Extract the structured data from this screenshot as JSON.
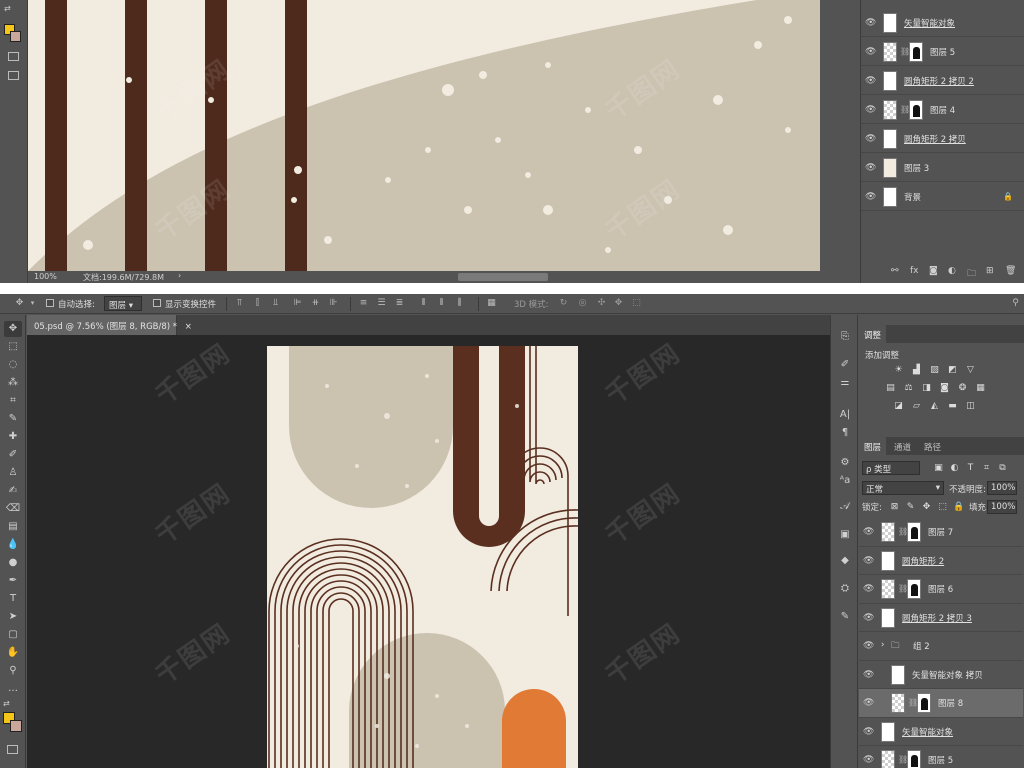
{
  "top": {
    "status_zoom": "100%",
    "status_doc": "文档:199.6M/729.8M",
    "layers": [
      {
        "name": "矢量智能对象",
        "smart": true,
        "type": "smart"
      },
      {
        "name": "图层 5",
        "smart": false,
        "type": "masked"
      },
      {
        "name": "圆角矩形 2 拷贝 2",
        "smart": true,
        "type": "smart"
      },
      {
        "name": "图层 4",
        "smart": false,
        "type": "masked"
      },
      {
        "name": "圆角矩形 2 拷贝",
        "smart": true,
        "type": "smart"
      },
      {
        "name": "图层 3",
        "smart": false,
        "type": "plain"
      },
      {
        "name": "背景",
        "smart": false,
        "type": "background"
      }
    ]
  },
  "options_bar": {
    "auto_select_label": "自动选择:",
    "auto_select_value": "图层",
    "show_transform_label": "显示变换控件",
    "mode_3d_label": "3D 模式:"
  },
  "document": {
    "tab_title": "05.psd @ 7.56% (图层 8, RGB/8) *",
    "tab_close": "×"
  },
  "adjustments_panel": {
    "tab_label": "调整",
    "add_label": "添加调整"
  },
  "layers_panel": {
    "tabs": [
      "图层",
      "通道",
      "路径"
    ],
    "kind_filter": "ρ 类型",
    "blend_mode": "正常",
    "opacity_label": "不透明度:",
    "opacity_value": "100%",
    "lock_label": "锁定:",
    "fill_label": "填充:",
    "fill_value": "100%",
    "layers": [
      {
        "name": "图层 7",
        "smart": false,
        "type": "masked",
        "indent": false
      },
      {
        "name": "圆角矩形 2",
        "smart": true,
        "type": "smart",
        "indent": false
      },
      {
        "name": "图层 6",
        "smart": false,
        "type": "masked",
        "indent": false
      },
      {
        "name": "圆角矩形 2 拷贝 3",
        "smart": true,
        "type": "smart",
        "indent": false
      },
      {
        "name": "组 2",
        "smart": false,
        "type": "group",
        "indent": false
      },
      {
        "name": "矢量智能对象 拷贝",
        "smart": false,
        "type": "smart",
        "indent": true
      },
      {
        "name": "图层 8",
        "smart": false,
        "type": "masked",
        "indent": true,
        "selected": true
      },
      {
        "name": "矢量智能对象",
        "smart": true,
        "type": "smart",
        "indent": false
      },
      {
        "name": "图层 5",
        "smart": false,
        "type": "masked",
        "indent": false
      }
    ]
  },
  "watermark_text": "千图网",
  "colors": {
    "ui_bg": "#535353",
    "canvas_cream": "#f1ebe0",
    "beige": "#cbc2b0",
    "brown": "#4e2a1c",
    "orange": "#e07a34",
    "foreground_swatch": "#f5c518",
    "background_swatch": "#c9a79a"
  }
}
